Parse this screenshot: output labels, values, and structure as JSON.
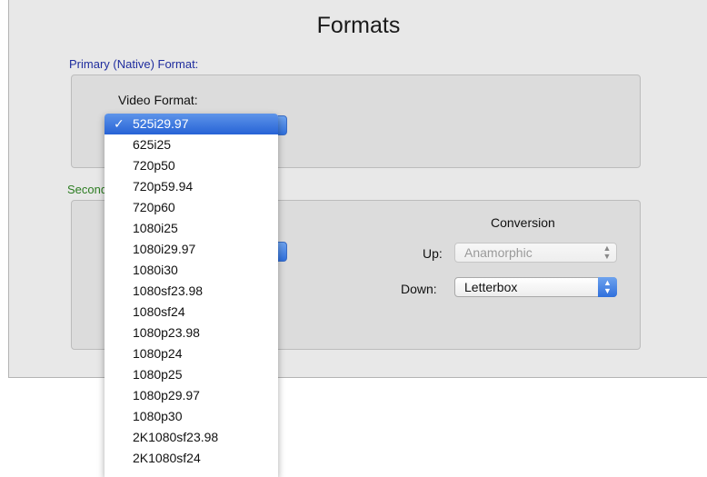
{
  "dialog": {
    "title": "Formats",
    "primary_section": "Primary (Native) Format:",
    "secondary_section": "Secondary (Cross) Format:",
    "video_format_label": "Video Format:"
  },
  "conversion": {
    "title": "Conversion",
    "up_label": "Up:",
    "up_value": "Anamorphic",
    "up_enabled": false,
    "down_label": "Down:",
    "down_value": "Letterbox"
  },
  "video_format_menu": {
    "selected": "525i29.97",
    "checkmark": "✓",
    "items": [
      "525i29.97",
      "625i25",
      "720p50",
      "720p59.94",
      "720p60",
      "1080i25",
      "1080i29.97",
      "1080i30",
      "1080sf23.98",
      "1080sf24",
      "1080p23.98",
      "1080p24",
      "1080p25",
      "1080p29.97",
      "1080p30",
      "2K1080sf23.98",
      "2K1080sf24"
    ]
  },
  "icons": {
    "popup_arrows": "up-down-arrows-icon"
  },
  "colors": {
    "primary_section": "#1f2d9e",
    "secondary_section": "#2d7d22",
    "selection": "#2763d6"
  }
}
